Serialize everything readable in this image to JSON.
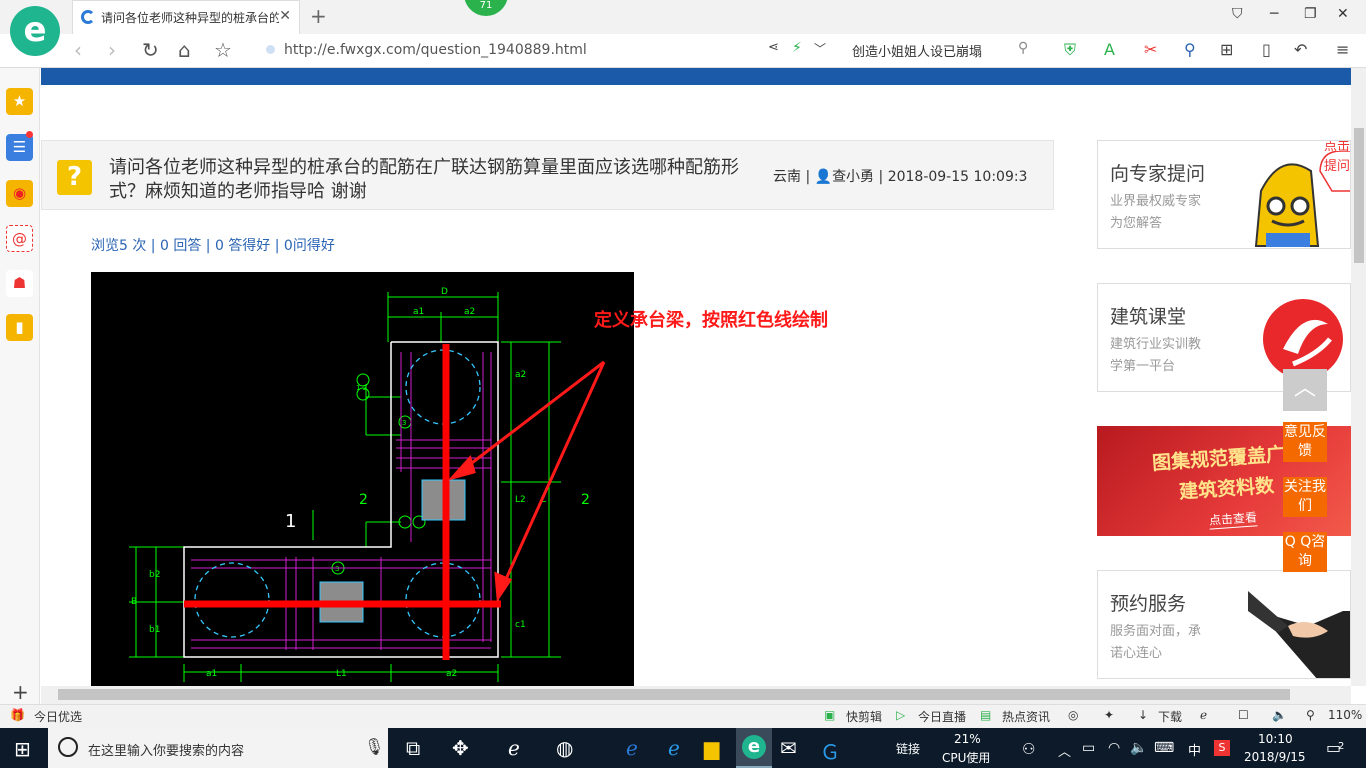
{
  "browser": {
    "tab_title": "请问各位老师这种异型的桩承台的",
    "tab_close": "✕",
    "new_tab": "+",
    "badge": "71",
    "url": "http://e.fwxgx.com/question_1940889.html",
    "search_text": "创造小姐姐人设已崩塌",
    "zoom": "110%",
    "status_left": "今日优选",
    "status_items": [
      "快剪辑",
      "今日直播",
      "热点资讯",
      "下载"
    ]
  },
  "question": {
    "title": "请问各位老师这种异型的桩承台的配筋在广联达钢筋算量里面应该选哪种配筋形式？麻烦知道的老师指导哈 谢谢",
    "location": "云南",
    "author": "查小勇",
    "datetime": "2018-09-15 10:09:3",
    "stats": "浏览5 次 | 0 回答 | 0 答得好 | 0问得好",
    "image_annotation": "定义承台梁，按照红色线绘制"
  },
  "cad": {
    "labels": [
      "D",
      "a1",
      "a2",
      "a2",
      "L2",
      "2",
      "2",
      "1",
      "1 2",
      "3",
      "3",
      "b2",
      "b1",
      "B",
      "a1",
      "L1",
      "a2",
      "L",
      "c1"
    ]
  },
  "sidebar_right": {
    "cards": [
      {
        "title": "向专家提问",
        "desc1": "业界最权威专家",
        "desc2": "为您解答"
      },
      {
        "title": "建筑课堂",
        "desc1": "建筑行业实训教",
        "desc2": "学第一平台"
      },
      {
        "title": "预约服务",
        "desc1": "服务面对面，承",
        "desc2": "诺心连心"
      }
    ],
    "banner": {
      "line1": "图集规范覆盖广",
      "line2": "建筑资料数",
      "link": "点击查看"
    },
    "bubble": "点击提问",
    "float_buttons": [
      "意见反馈",
      "关注我们",
      "Q Q咨询"
    ]
  },
  "taskbar": {
    "search_placeholder": "在这里输入你要搜索的内容",
    "link_label": "链接",
    "cpu_value": "21%",
    "cpu_label": "CPU使用",
    "ime": "中",
    "time": "10:10",
    "date": "2018/9/15",
    "notify_count": "2"
  },
  "colors": {
    "brand_blue": "#1a5aa8",
    "accent_orange": "#f46a00",
    "cad_red": "#ff0000",
    "question_yellow": "#f5c400"
  }
}
